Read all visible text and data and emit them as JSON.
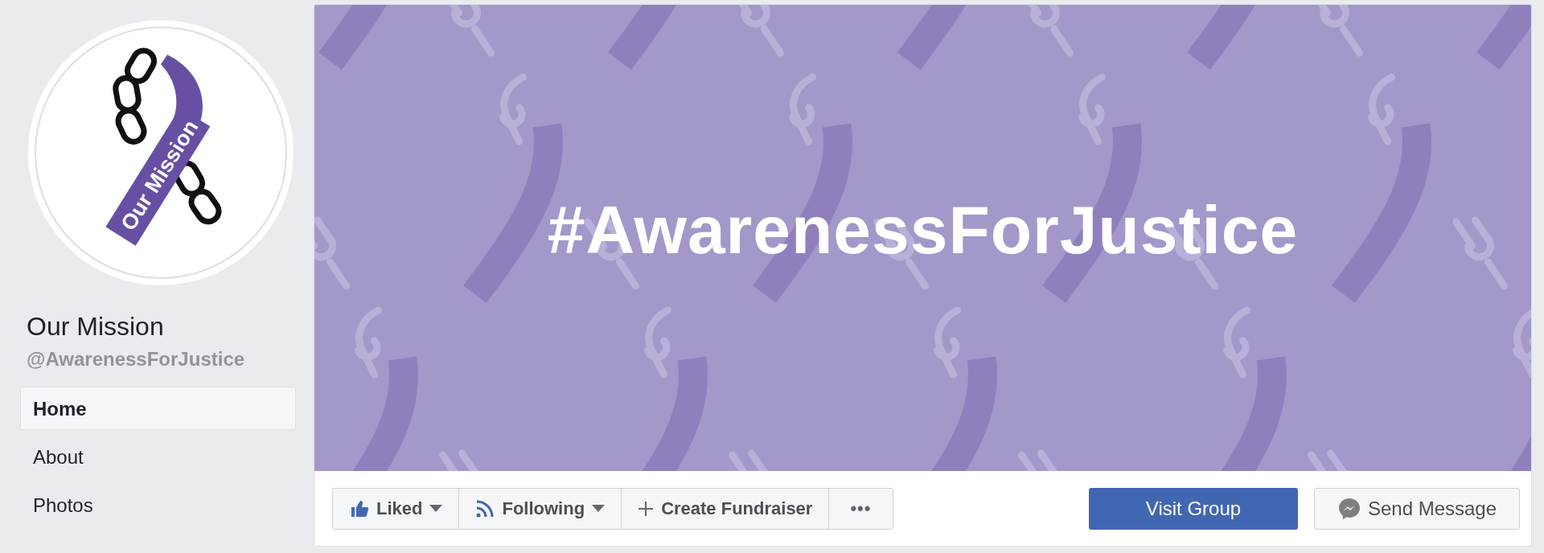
{
  "page": {
    "name": "Our Mission",
    "handle": "@AwarenessForJustice",
    "logo_text": "Our Mission"
  },
  "nav": [
    {
      "label": "Home",
      "selected": true
    },
    {
      "label": "About",
      "selected": false
    },
    {
      "label": "Photos",
      "selected": false
    }
  ],
  "cover": {
    "heading": "#AwarenessForJustice"
  },
  "actions": [
    {
      "kind": "like",
      "label": "Liked",
      "dropdown": true
    },
    {
      "kind": "follow",
      "label": "Following",
      "dropdown": true
    },
    {
      "kind": "add",
      "label": "Create Fundraiser",
      "dropdown": false
    },
    {
      "kind": "more",
      "label": "•••",
      "dropdown": false
    }
  ],
  "visit_button": "Visit Group",
  "message_button": "Send Message"
}
